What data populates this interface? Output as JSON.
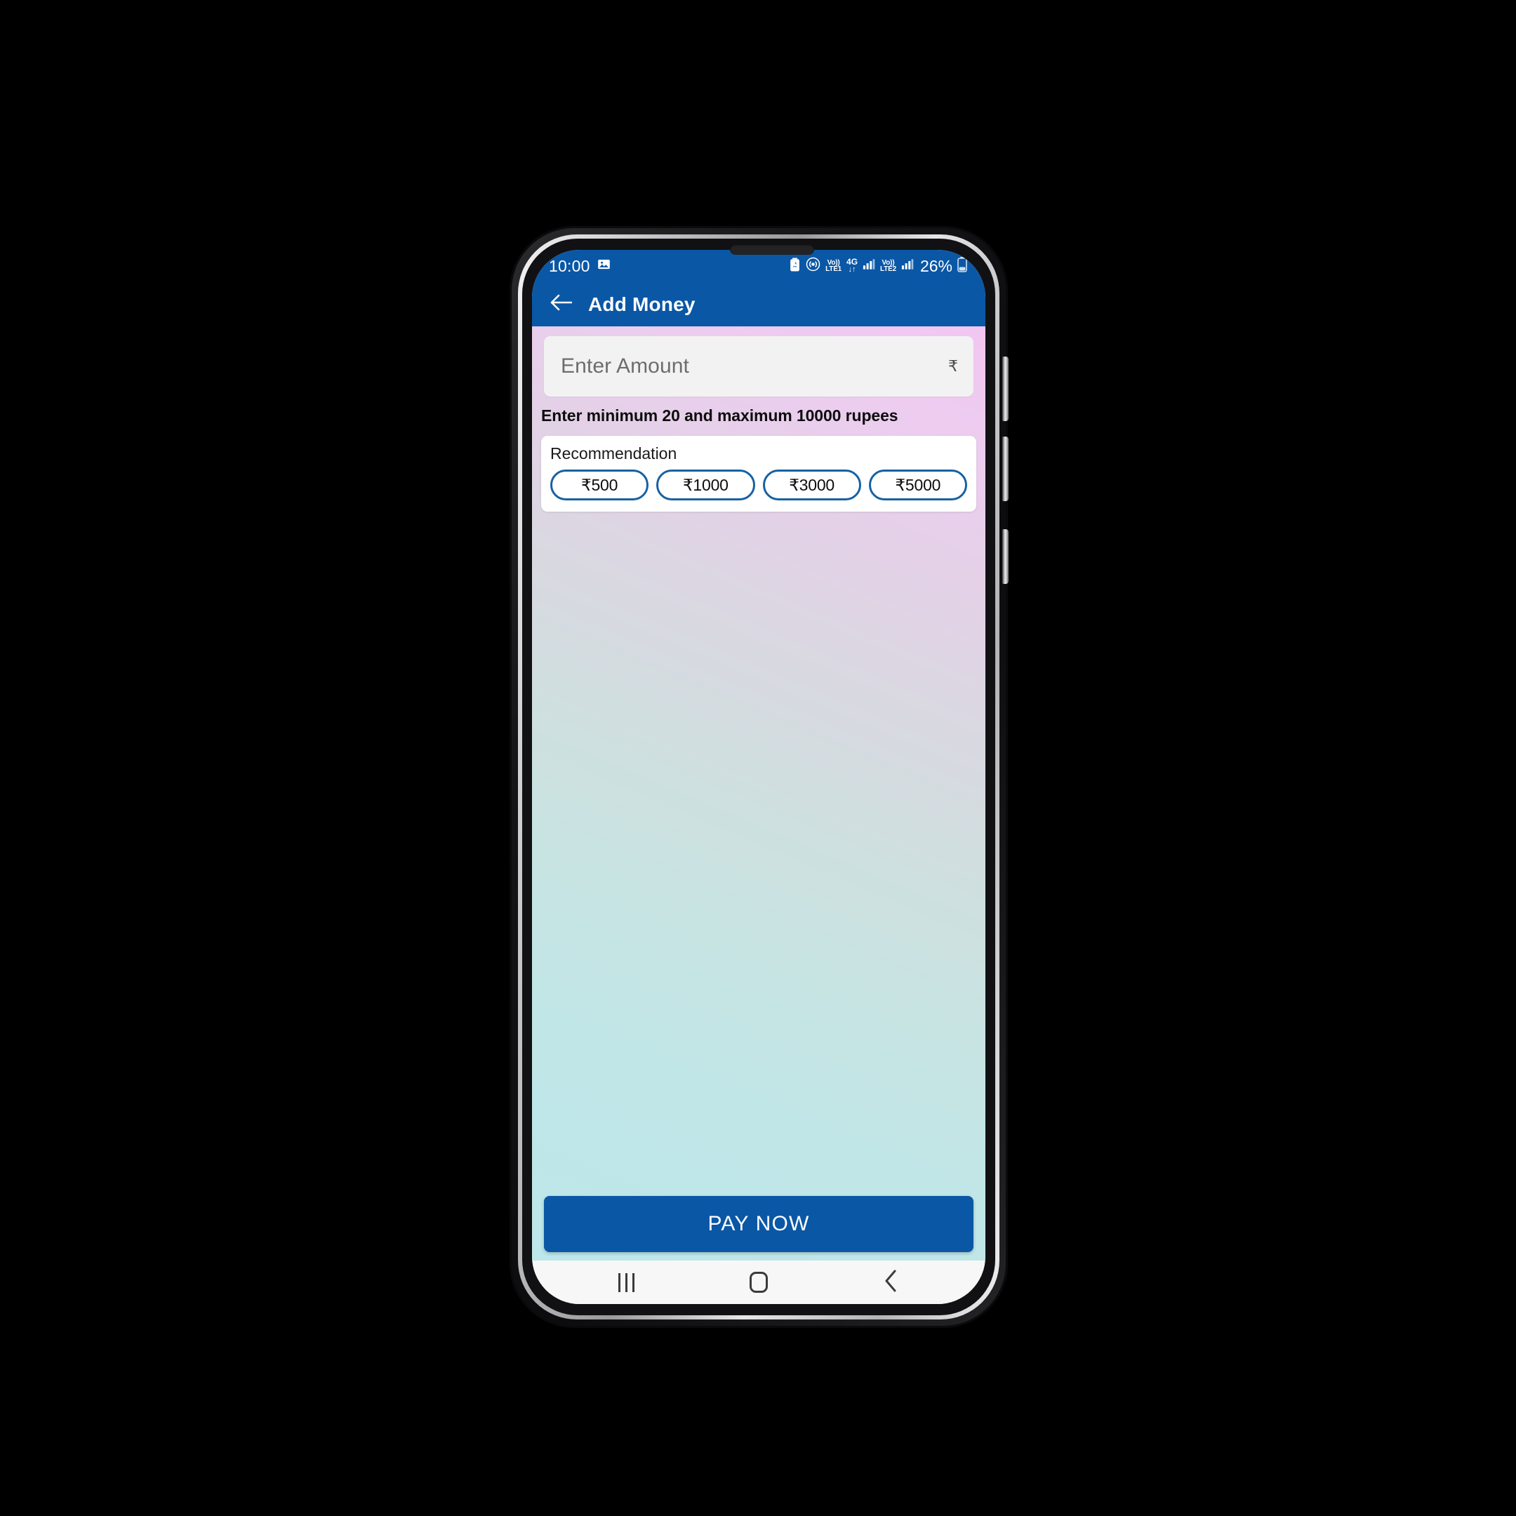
{
  "device": {
    "name": "android-phone",
    "statusbar": {
      "time": "10:00",
      "icons_left": [
        "photo-icon"
      ],
      "icons_right": [
        "battery-saver-icon",
        "hotspot-icon",
        "volte-lte1-icon",
        "network-4g-icon",
        "signal-bars-sim1-icon",
        "volte-lte2-icon",
        "signal-bars-sim2-icon"
      ],
      "sim1_label": "Vo))",
      "sim1_tech": "LTE1",
      "sim2_label": "Vo))",
      "sim2_tech": "LTE2",
      "network_generation": "4G",
      "battery_percent": "26%"
    },
    "navbar": {
      "recents_label": "recent-apps",
      "home_label": "home",
      "back_label": "back"
    }
  },
  "appbar": {
    "back_icon": "arrow-left-icon",
    "title": "Add Money",
    "background": "#0a57a6"
  },
  "amount_input": {
    "placeholder": "Enter Amount",
    "value": "",
    "currency_symbol": "₹"
  },
  "hint": {
    "text": "Enter minimum 20 and maximum 10000 rupees",
    "minimum": 20,
    "maximum": 10000
  },
  "recommendation": {
    "title": "Recommendation",
    "chips": [
      {
        "label": "₹500",
        "amount": 500
      },
      {
        "label": "₹1000",
        "amount": 1000
      },
      {
        "label": "₹3000",
        "amount": 3000
      },
      {
        "label": "₹5000",
        "amount": 5000
      }
    ],
    "border_color": "#1761a3"
  },
  "pay_button": {
    "label": "PAY NOW",
    "background": "#0a57a6",
    "text_color": "#ffffff"
  },
  "theme": {
    "primary": "#0a57a6",
    "gradient_top": "#f2c6f2",
    "gradient_bottom": "#bde7ea",
    "card_background": "#ffffff",
    "field_background": "#f2f2f2"
  }
}
